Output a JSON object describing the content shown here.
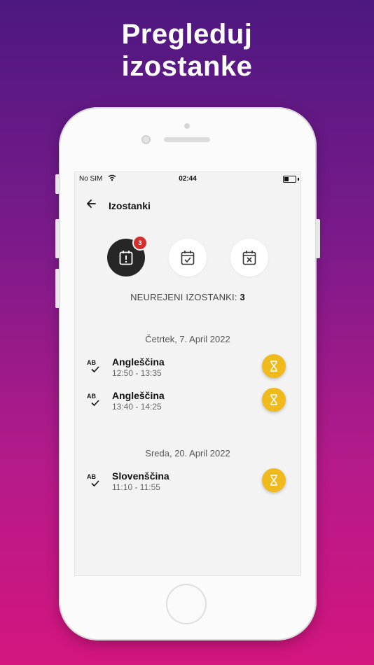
{
  "headline": {
    "line1": "Pregleduj",
    "line2": "izostanke"
  },
  "status_bar": {
    "carrier": "No SIM",
    "time": "02:44"
  },
  "header": {
    "title": "Izostanki"
  },
  "filters": {
    "unresolved_badge": "3"
  },
  "summary": {
    "label": "NEUREJENI IZOSTANKI:",
    "count": "3"
  },
  "groups": [
    {
      "date": "Četrtek, 7. April 2022",
      "items": [
        {
          "subject": "Angleščina",
          "time": "12:50 - 13:35",
          "status_icon": "hourglass-icon"
        },
        {
          "subject": "Angleščina",
          "time": "13:40 - 14:25",
          "status_icon": "hourglass-icon"
        }
      ]
    },
    {
      "date": "Sreda, 20. April 2022",
      "items": [
        {
          "subject": "Slovenščina",
          "time": "11:10 - 11:55",
          "status_icon": "hourglass-icon"
        }
      ]
    }
  ],
  "colors": {
    "accent": "#f0b91c",
    "badge": "#d32f2f",
    "active_filter": "#262626"
  }
}
